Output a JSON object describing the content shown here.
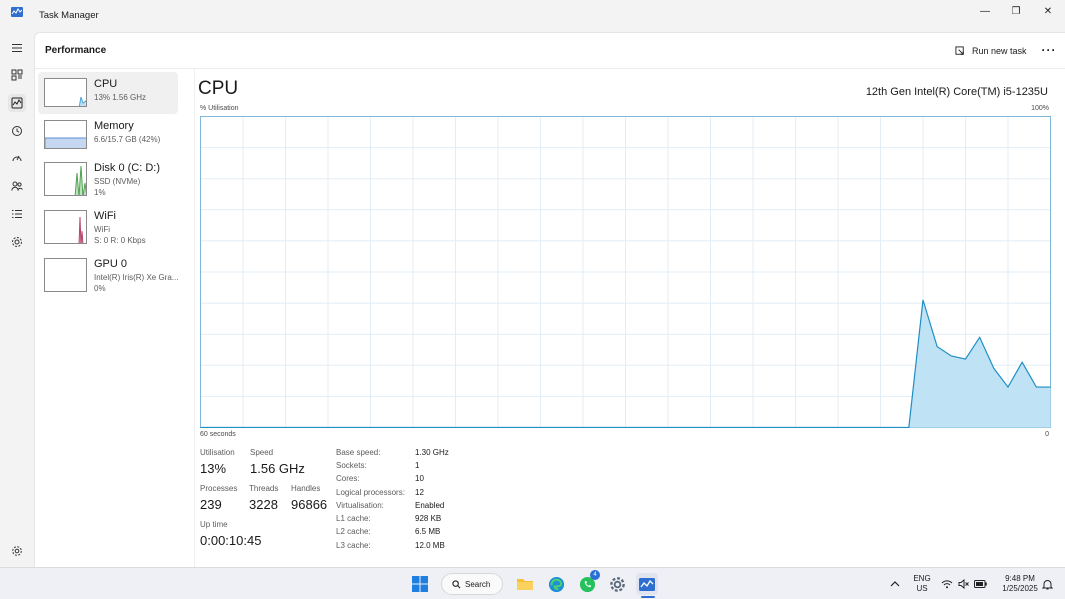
{
  "window": {
    "title": "Task Manager",
    "minimize_glyph": "—",
    "restore_glyph": "❐",
    "close_glyph": "✕"
  },
  "header": {
    "page_title": "Performance",
    "run_new_task_label": "Run new task",
    "more_glyph": "···"
  },
  "nav_icons": [
    "hamburger-icon",
    "processes-icon",
    "performance-icon",
    "app-history-icon",
    "startup-icon",
    "users-icon",
    "details-icon",
    "services-icon",
    "settings-icon"
  ],
  "devices": [
    {
      "name": "CPU",
      "line1": "13%  1.56 GHz",
      "line2": "",
      "color": "#4aa5d9",
      "selected": true
    },
    {
      "name": "Memory",
      "line1": "6.6/15.7 GB (42%)",
      "line2": "",
      "color": "#5b8fd6",
      "selected": false
    },
    {
      "name": "Disk 0 (C: D:)",
      "line1": "SSD (NVMe)",
      "line2": "1%",
      "color": "#4fa34f",
      "selected": false
    },
    {
      "name": "WiFi",
      "line1": "WiFi",
      "line2": "S: 0 R: 0 Kbps",
      "color": "#b5446a",
      "selected": false
    },
    {
      "name": "GPU 0",
      "line1": "Intel(R) Iris(R) Xe Gra...",
      "line2": "0%",
      "color": "#4aa5d9",
      "selected": false
    }
  ],
  "cpu": {
    "heading": "CPU",
    "model": "12th Gen Intel(R) Core(TM) i5-1235U",
    "util_label": "% Utilisation",
    "util_max": "100%",
    "time_label": "60 seconds",
    "zero_label": "0",
    "line_color": "#1e8fc4",
    "fill_color": "#bfe3f5",
    "stats": {
      "utilisation_label": "Utilisation",
      "utilisation": "13%",
      "speed_label": "Speed",
      "speed": "1.56 GHz",
      "processes_label": "Processes",
      "processes": "239",
      "threads_label": "Threads",
      "threads": "3228",
      "handles_label": "Handles",
      "handles": "96866",
      "uptime_label": "Up time",
      "uptime": "0:00:10:45"
    },
    "specs": [
      {
        "label": "Base speed:",
        "value": "1.30 GHz"
      },
      {
        "label": "Sockets:",
        "value": "1"
      },
      {
        "label": "Cores:",
        "value": "10"
      },
      {
        "label": "Logical processors:",
        "value": "12"
      },
      {
        "label": "Virtualisation:",
        "value": "Enabled"
      },
      {
        "label": "L1 cache:",
        "value": "928 KB"
      },
      {
        "label": "L2 cache:",
        "value": "6.5 MB"
      },
      {
        "label": "L3 cache:",
        "value": "12.0 MB"
      }
    ]
  },
  "chart_data": {
    "type": "area",
    "title": "",
    "ylabel": "% Utilisation",
    "xlabel": "60 seconds",
    "xlim": [
      60,
      0
    ],
    "ylim": [
      0,
      100
    ],
    "grid": true,
    "x": [
      60,
      10,
      9,
      8,
      7,
      6,
      5,
      4,
      3,
      2,
      1,
      0
    ],
    "values": [
      0,
      0,
      41,
      26,
      23,
      22,
      29,
      19,
      13,
      21,
      13,
      13
    ]
  },
  "taskbar": {
    "search_label": "Search",
    "whatsapp_badge": "4",
    "apps": [
      "windows-start-icon",
      "search-icon",
      "file-explorer-icon",
      "edge-icon",
      "whatsapp-icon",
      "settings-app-icon",
      "task-manager-icon"
    ],
    "lang_top": "ENG",
    "lang_bottom": "US",
    "time": "9:48 PM",
    "date": "1/25/2025"
  }
}
